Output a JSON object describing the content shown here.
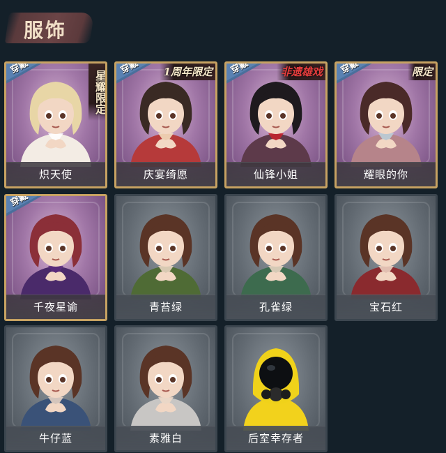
{
  "header": {
    "title": "服饰"
  },
  "wear_label": "穿戴",
  "costumes": [
    {
      "name": "炽天使",
      "owned": true,
      "tag": "星耀限定",
      "tag_color": "#f5e7c9",
      "hair": "#e8d6a6",
      "outfit": "#f3ece4",
      "accent": "#ffffff"
    },
    {
      "name": "庆宴绮愿",
      "owned": true,
      "tag": "1周年限定",
      "tag_color": "#f5e7c9",
      "hair": "#3a2a24",
      "outfit": "#b63a3a",
      "accent": "#f6e6c4"
    },
    {
      "name": "仙锋小姐",
      "owned": true,
      "tag": "非遗雄戏",
      "tag_color": "#e63d3d",
      "hair": "#1e1a1e",
      "outfit": "#5d3a4a",
      "accent": "#c9232c"
    },
    {
      "name": "耀眼的你",
      "owned": true,
      "tag": "限定",
      "tag_color": "#f5e7c9",
      "hair": "#4a2a28",
      "outfit": "#b6848a",
      "accent": "#bcd2dc"
    },
    {
      "name": "千夜星谕",
      "owned": true,
      "tag": "",
      "tag_color": "#f5e7c9",
      "hair": "#8b2f38",
      "outfit": "#4a2a6a",
      "accent": "#5b2c7c"
    },
    {
      "name": "青苔绿",
      "owned": false,
      "tag": "",
      "tag_color": "#f5e7c9",
      "hair": "#5a3426",
      "outfit": "#4f6b35",
      "accent": "#f0d9c8"
    },
    {
      "name": "孔雀绿",
      "owned": false,
      "tag": "",
      "tag_color": "#f5e7c9",
      "hair": "#5a3426",
      "outfit": "#3d6b4e",
      "accent": "#f0d9c8"
    },
    {
      "name": "宝石红",
      "owned": false,
      "tag": "",
      "tag_color": "#f5e7c9",
      "hair": "#5a3426",
      "outfit": "#8a2a2e",
      "accent": "#f0d9c8"
    },
    {
      "name": "牛仔蓝",
      "owned": false,
      "tag": "",
      "tag_color": "#f5e7c9",
      "hair": "#5a3426",
      "outfit": "#3a5278",
      "accent": "#f0d9c8"
    },
    {
      "name": "素雅白",
      "owned": false,
      "tag": "",
      "tag_color": "#f5e7c9",
      "hair": "#5a3426",
      "outfit": "#c8c6c4",
      "accent": "#f0d9c8"
    },
    {
      "name": "后室幸存者",
      "owned": false,
      "tag": "",
      "tag_color": "#f5e7c9",
      "hair": "#f0d21a",
      "outfit": "#f2d21c",
      "accent": "#1a1a1a",
      "hazmat": true
    }
  ]
}
